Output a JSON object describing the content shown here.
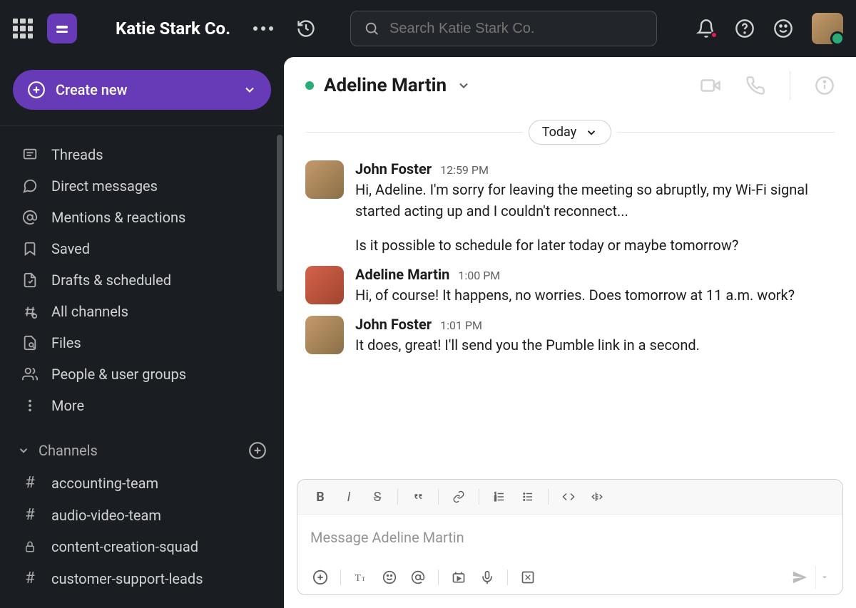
{
  "topbar": {
    "workspace": "Katie Stark Co.",
    "search_placeholder": "Search Katie Stark Co."
  },
  "sidebar": {
    "create_label": "Create new",
    "nav": [
      {
        "icon": "threads",
        "label": "Threads"
      },
      {
        "icon": "dm",
        "label": "Direct messages"
      },
      {
        "icon": "mentions",
        "label": "Mentions & reactions"
      },
      {
        "icon": "saved",
        "label": "Saved"
      },
      {
        "icon": "drafts",
        "label": "Drafts & scheduled"
      },
      {
        "icon": "allchannels",
        "label": "All channels"
      },
      {
        "icon": "files",
        "label": "Files"
      },
      {
        "icon": "people",
        "label": "People & user groups"
      },
      {
        "icon": "more",
        "label": "More"
      }
    ],
    "channels_header": "Channels",
    "channels": [
      {
        "prefix": "#",
        "label": "accounting-team"
      },
      {
        "prefix": "#",
        "label": "audio-video-team"
      },
      {
        "prefix": "lock",
        "label": "content-creation-squad"
      },
      {
        "prefix": "#",
        "label": "customer-support-leads"
      }
    ]
  },
  "chat": {
    "title": "Adeline Martin",
    "date_label": "Today",
    "compose_placeholder": "Message Adeline Martin",
    "messages": [
      {
        "author": "John Foster",
        "avatar": "jf",
        "time": "12:59 PM",
        "paras": [
          "Hi, Adeline. I'm sorry for leaving the meeting so abruptly, my Wi-Fi signal started acting up and I couldn't reconnect...",
          "Is it possible to schedule for later today or maybe tomorrow?"
        ]
      },
      {
        "author": "Adeline Martin",
        "avatar": "am",
        "time": "1:00 PM",
        "paras": [
          "Hi, of course! It happens, no worries. Does tomorrow at 11 a.m. work?"
        ]
      },
      {
        "author": "John Foster",
        "avatar": "jf",
        "time": "1:01 PM",
        "paras": [
          "It does, great! I'll send you the Pumble link in a second."
        ]
      }
    ]
  }
}
